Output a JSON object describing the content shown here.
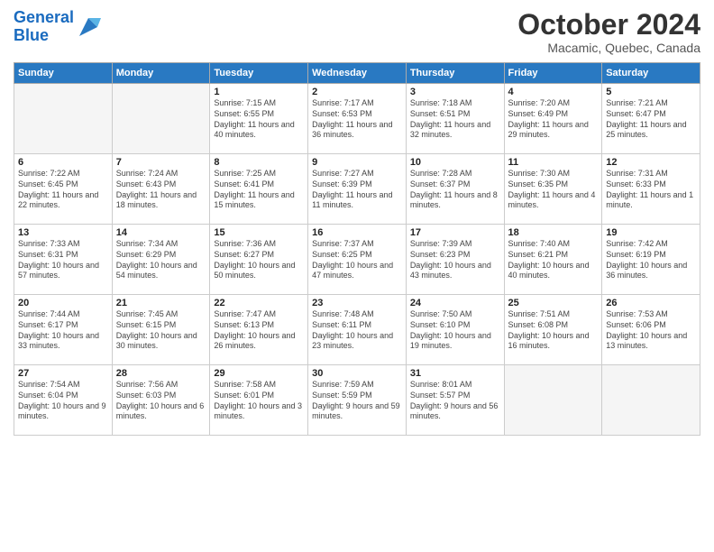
{
  "logo": {
    "line1": "General",
    "line2": "Blue"
  },
  "title": "October 2024",
  "subtitle": "Macamic, Quebec, Canada",
  "days": [
    "Sunday",
    "Monday",
    "Tuesday",
    "Wednesday",
    "Thursday",
    "Friday",
    "Saturday"
  ],
  "weeks": [
    [
      {
        "date": "",
        "sunrise": "",
        "sunset": "",
        "daylight": ""
      },
      {
        "date": "",
        "sunrise": "",
        "sunset": "",
        "daylight": ""
      },
      {
        "date": "1",
        "sunrise": "Sunrise: 7:15 AM",
        "sunset": "Sunset: 6:55 PM",
        "daylight": "Daylight: 11 hours and 40 minutes."
      },
      {
        "date": "2",
        "sunrise": "Sunrise: 7:17 AM",
        "sunset": "Sunset: 6:53 PM",
        "daylight": "Daylight: 11 hours and 36 minutes."
      },
      {
        "date": "3",
        "sunrise": "Sunrise: 7:18 AM",
        "sunset": "Sunset: 6:51 PM",
        "daylight": "Daylight: 11 hours and 32 minutes."
      },
      {
        "date": "4",
        "sunrise": "Sunrise: 7:20 AM",
        "sunset": "Sunset: 6:49 PM",
        "daylight": "Daylight: 11 hours and 29 minutes."
      },
      {
        "date": "5",
        "sunrise": "Sunrise: 7:21 AM",
        "sunset": "Sunset: 6:47 PM",
        "daylight": "Daylight: 11 hours and 25 minutes."
      }
    ],
    [
      {
        "date": "6",
        "sunrise": "Sunrise: 7:22 AM",
        "sunset": "Sunset: 6:45 PM",
        "daylight": "Daylight: 11 hours and 22 minutes."
      },
      {
        "date": "7",
        "sunrise": "Sunrise: 7:24 AM",
        "sunset": "Sunset: 6:43 PM",
        "daylight": "Daylight: 11 hours and 18 minutes."
      },
      {
        "date": "8",
        "sunrise": "Sunrise: 7:25 AM",
        "sunset": "Sunset: 6:41 PM",
        "daylight": "Daylight: 11 hours and 15 minutes."
      },
      {
        "date": "9",
        "sunrise": "Sunrise: 7:27 AM",
        "sunset": "Sunset: 6:39 PM",
        "daylight": "Daylight: 11 hours and 11 minutes."
      },
      {
        "date": "10",
        "sunrise": "Sunrise: 7:28 AM",
        "sunset": "Sunset: 6:37 PM",
        "daylight": "Daylight: 11 hours and 8 minutes."
      },
      {
        "date": "11",
        "sunrise": "Sunrise: 7:30 AM",
        "sunset": "Sunset: 6:35 PM",
        "daylight": "Daylight: 11 hours and 4 minutes."
      },
      {
        "date": "12",
        "sunrise": "Sunrise: 7:31 AM",
        "sunset": "Sunset: 6:33 PM",
        "daylight": "Daylight: 11 hours and 1 minute."
      }
    ],
    [
      {
        "date": "13",
        "sunrise": "Sunrise: 7:33 AM",
        "sunset": "Sunset: 6:31 PM",
        "daylight": "Daylight: 10 hours and 57 minutes."
      },
      {
        "date": "14",
        "sunrise": "Sunrise: 7:34 AM",
        "sunset": "Sunset: 6:29 PM",
        "daylight": "Daylight: 10 hours and 54 minutes."
      },
      {
        "date": "15",
        "sunrise": "Sunrise: 7:36 AM",
        "sunset": "Sunset: 6:27 PM",
        "daylight": "Daylight: 10 hours and 50 minutes."
      },
      {
        "date": "16",
        "sunrise": "Sunrise: 7:37 AM",
        "sunset": "Sunset: 6:25 PM",
        "daylight": "Daylight: 10 hours and 47 minutes."
      },
      {
        "date": "17",
        "sunrise": "Sunrise: 7:39 AM",
        "sunset": "Sunset: 6:23 PM",
        "daylight": "Daylight: 10 hours and 43 minutes."
      },
      {
        "date": "18",
        "sunrise": "Sunrise: 7:40 AM",
        "sunset": "Sunset: 6:21 PM",
        "daylight": "Daylight: 10 hours and 40 minutes."
      },
      {
        "date": "19",
        "sunrise": "Sunrise: 7:42 AM",
        "sunset": "Sunset: 6:19 PM",
        "daylight": "Daylight: 10 hours and 36 minutes."
      }
    ],
    [
      {
        "date": "20",
        "sunrise": "Sunrise: 7:44 AM",
        "sunset": "Sunset: 6:17 PM",
        "daylight": "Daylight: 10 hours and 33 minutes."
      },
      {
        "date": "21",
        "sunrise": "Sunrise: 7:45 AM",
        "sunset": "Sunset: 6:15 PM",
        "daylight": "Daylight: 10 hours and 30 minutes."
      },
      {
        "date": "22",
        "sunrise": "Sunrise: 7:47 AM",
        "sunset": "Sunset: 6:13 PM",
        "daylight": "Daylight: 10 hours and 26 minutes."
      },
      {
        "date": "23",
        "sunrise": "Sunrise: 7:48 AM",
        "sunset": "Sunset: 6:11 PM",
        "daylight": "Daylight: 10 hours and 23 minutes."
      },
      {
        "date": "24",
        "sunrise": "Sunrise: 7:50 AM",
        "sunset": "Sunset: 6:10 PM",
        "daylight": "Daylight: 10 hours and 19 minutes."
      },
      {
        "date": "25",
        "sunrise": "Sunrise: 7:51 AM",
        "sunset": "Sunset: 6:08 PM",
        "daylight": "Daylight: 10 hours and 16 minutes."
      },
      {
        "date": "26",
        "sunrise": "Sunrise: 7:53 AM",
        "sunset": "Sunset: 6:06 PM",
        "daylight": "Daylight: 10 hours and 13 minutes."
      }
    ],
    [
      {
        "date": "27",
        "sunrise": "Sunrise: 7:54 AM",
        "sunset": "Sunset: 6:04 PM",
        "daylight": "Daylight: 10 hours and 9 minutes."
      },
      {
        "date": "28",
        "sunrise": "Sunrise: 7:56 AM",
        "sunset": "Sunset: 6:03 PM",
        "daylight": "Daylight: 10 hours and 6 minutes."
      },
      {
        "date": "29",
        "sunrise": "Sunrise: 7:58 AM",
        "sunset": "Sunset: 6:01 PM",
        "daylight": "Daylight: 10 hours and 3 minutes."
      },
      {
        "date": "30",
        "sunrise": "Sunrise: 7:59 AM",
        "sunset": "Sunset: 5:59 PM",
        "daylight": "Daylight: 9 hours and 59 minutes."
      },
      {
        "date": "31",
        "sunrise": "Sunrise: 8:01 AM",
        "sunset": "Sunset: 5:57 PM",
        "daylight": "Daylight: 9 hours and 56 minutes."
      },
      {
        "date": "",
        "sunrise": "",
        "sunset": "",
        "daylight": ""
      },
      {
        "date": "",
        "sunrise": "",
        "sunset": "",
        "daylight": ""
      }
    ]
  ]
}
